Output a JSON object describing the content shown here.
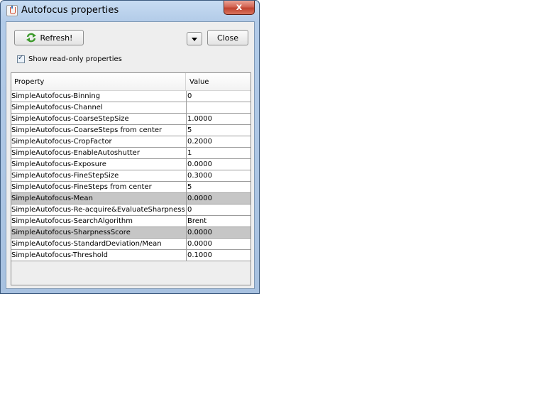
{
  "window": {
    "title": "Autofocus properties",
    "close_glyph": "x"
  },
  "toolbar": {
    "refresh_label": "Refresh!",
    "refresh_icon": "refresh-arrows-icon",
    "close_label": "Close",
    "dropdown_icon": "chevron-down-icon"
  },
  "options": {
    "show_readonly_label": "Show read-only properties",
    "show_readonly_checked": true
  },
  "table": {
    "columns": [
      "Property",
      "Value"
    ],
    "rows": [
      {
        "property": "SimpleAutofocus-Binning",
        "value": "0",
        "selected": false
      },
      {
        "property": "SimpleAutofocus-Channel",
        "value": "",
        "selected": false
      },
      {
        "property": "SimpleAutofocus-CoarseStepSize",
        "value": "1.0000",
        "selected": false
      },
      {
        "property": "SimpleAutofocus-CoarseSteps from center",
        "value": "5",
        "selected": false
      },
      {
        "property": "SimpleAutofocus-CropFactor",
        "value": "0.2000",
        "selected": false
      },
      {
        "property": "SimpleAutofocus-EnableAutoshutter",
        "value": "1",
        "selected": false
      },
      {
        "property": "SimpleAutofocus-Exposure",
        "value": "0.0000",
        "selected": false
      },
      {
        "property": "SimpleAutofocus-FineStepSize",
        "value": "0.3000",
        "selected": false
      },
      {
        "property": "SimpleAutofocus-FineSteps from center",
        "value": "5",
        "selected": false
      },
      {
        "property": "SimpleAutofocus-Mean",
        "value": "0.0000",
        "selected": true
      },
      {
        "property": "SimpleAutofocus-Re-acquire&EvaluateSharpness",
        "value": "0",
        "selected": false
      },
      {
        "property": "SimpleAutofocus-SearchAlgorithm",
        "value": "Brent",
        "selected": false
      },
      {
        "property": "SimpleAutofocus-SharpnessScore",
        "value": "0.0000",
        "selected": true
      },
      {
        "property": "SimpleAutofocus-StandardDeviation/Mean",
        "value": "0.0000",
        "selected": false
      },
      {
        "property": "SimpleAutofocus-Threshold",
        "value": "0.1000",
        "selected": false
      }
    ]
  },
  "colors": {
    "readonly_row": "#c6c6c6",
    "close_button": "#c0432f"
  }
}
